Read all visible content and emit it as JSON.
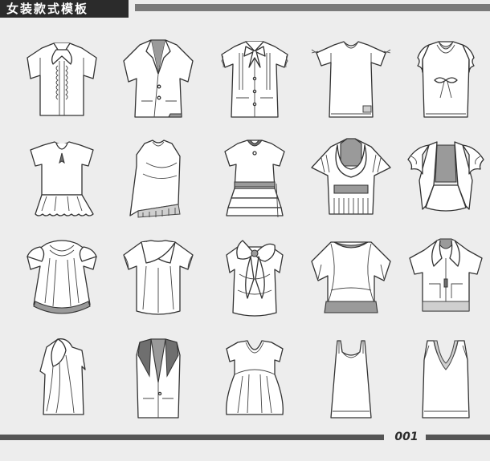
{
  "header": {
    "title": "女装款式模板"
  },
  "footer": {
    "page_number": "001"
  },
  "colors": {
    "header_bar": "#2b2b2b",
    "rule": "#7a7a7a",
    "background": "#ededed",
    "garment_fill": "#ffffff",
    "garment_shade": "#9a9a9a"
  }
}
